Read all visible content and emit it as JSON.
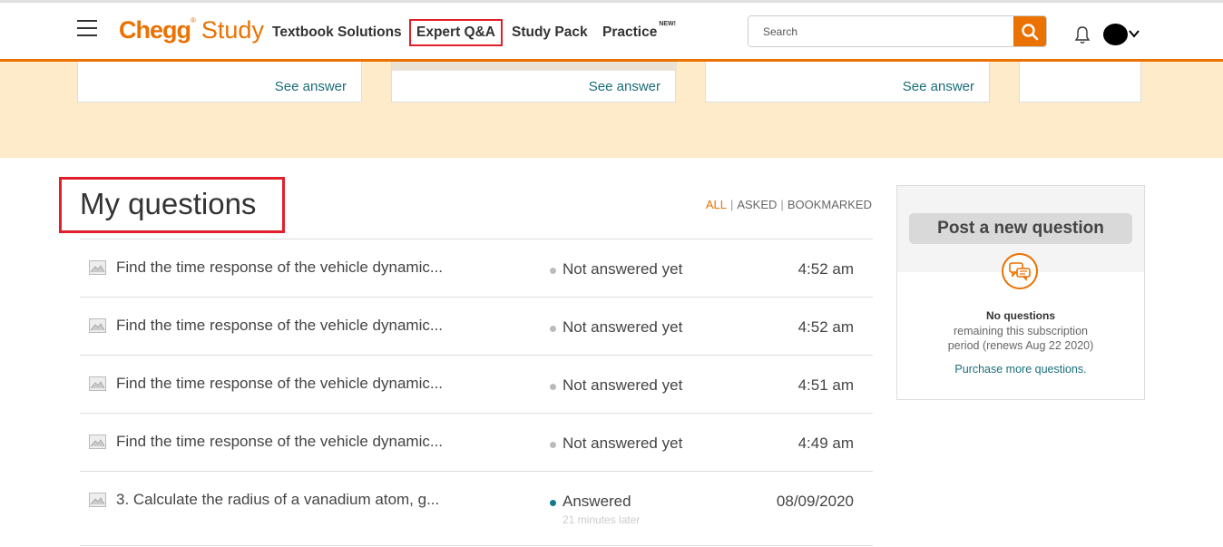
{
  "header": {
    "logo_chegg": "Chegg",
    "logo_study": "Study",
    "nav": {
      "textbook": "Textbook Solutions",
      "expert": "Expert Q&A",
      "studypack": "Study Pack",
      "practice": "Practice",
      "practice_badge": "NEW!"
    },
    "search_placeholder": "Search"
  },
  "banner": {
    "cards": [
      {
        "link": "See answer"
      },
      {
        "link": "See answer"
      },
      {
        "link": "See answer"
      }
    ]
  },
  "main": {
    "title": "My questions",
    "filters": {
      "all": "ALL",
      "asked": "ASKED",
      "bookmarked": "BOOKMARKED"
    },
    "questions": [
      {
        "text": "Find the time response of the vehicle dynamic...",
        "status": "Not answered yet",
        "time": "4:52 am"
      },
      {
        "text": "Find the time response of the vehicle dynamic...",
        "status": "Not answered yet",
        "time": "4:52 am"
      },
      {
        "text": "Find the time response of the vehicle dynamic...",
        "status": "Not answered yet",
        "time": "4:51 am"
      },
      {
        "text": "Find the time response of the vehicle dynamic...",
        "status": "Not answered yet",
        "time": "4:49 am"
      },
      {
        "text": "3. Calculate the radius of a vanadium atom, g...",
        "status": "Answered",
        "sub": "21 minutes later",
        "time": "08/09/2020"
      }
    ]
  },
  "side": {
    "post_button": "Post a new question",
    "no_questions": "No questions",
    "remaining_line1": "remaining this subscription",
    "remaining_line2": "period (renews Aug 22  2020)",
    "purchase": "Purchase more questions."
  },
  "colors": {
    "brand": "#eb7100",
    "link": "#1a6d78",
    "highlight": "#e0202a"
  }
}
